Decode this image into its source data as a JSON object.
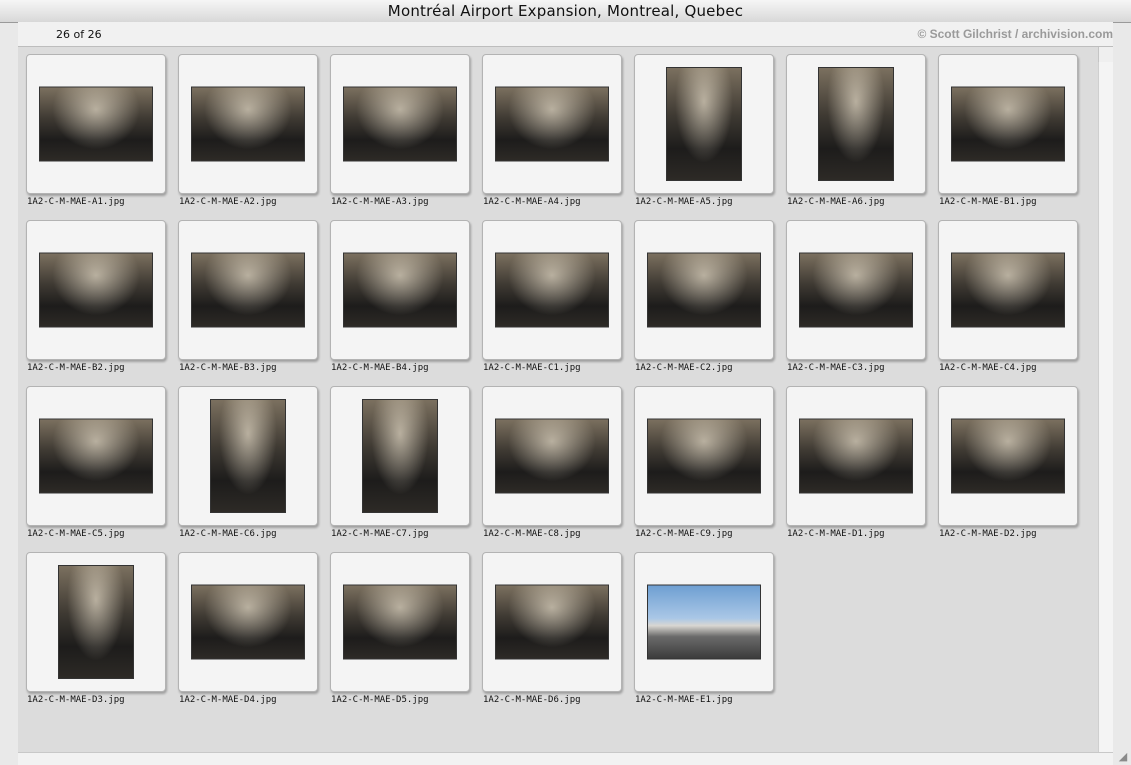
{
  "window": {
    "title": "Montréal Airport Expansion, Montreal, Quebec"
  },
  "header": {
    "counter": "26 of 26",
    "credit": "© Scott Gilchrist / archivision.com"
  },
  "thumbnails": [
    {
      "filename": "1A2-C-M-MAE-A1.jpg",
      "orientation": "landscape"
    },
    {
      "filename": "1A2-C-M-MAE-A2.jpg",
      "orientation": "landscape"
    },
    {
      "filename": "1A2-C-M-MAE-A3.jpg",
      "orientation": "landscape"
    },
    {
      "filename": "1A2-C-M-MAE-A4.jpg",
      "orientation": "landscape"
    },
    {
      "filename": "1A2-C-M-MAE-A5.jpg",
      "orientation": "portrait"
    },
    {
      "filename": "1A2-C-M-MAE-A6.jpg",
      "orientation": "portrait"
    },
    {
      "filename": "1A2-C-M-MAE-B1.jpg",
      "orientation": "landscape"
    },
    {
      "filename": "1A2-C-M-MAE-B2.jpg",
      "orientation": "landscape"
    },
    {
      "filename": "1A2-C-M-MAE-B3.jpg",
      "orientation": "landscape"
    },
    {
      "filename": "1A2-C-M-MAE-B4.jpg",
      "orientation": "landscape"
    },
    {
      "filename": "1A2-C-M-MAE-C1.jpg",
      "orientation": "landscape"
    },
    {
      "filename": "1A2-C-M-MAE-C2.jpg",
      "orientation": "landscape"
    },
    {
      "filename": "1A2-C-M-MAE-C3.jpg",
      "orientation": "landscape"
    },
    {
      "filename": "1A2-C-M-MAE-C4.jpg",
      "orientation": "landscape"
    },
    {
      "filename": "1A2-C-M-MAE-C5.jpg",
      "orientation": "landscape"
    },
    {
      "filename": "1A2-C-M-MAE-C6.jpg",
      "orientation": "portrait"
    },
    {
      "filename": "1A2-C-M-MAE-C7.jpg",
      "orientation": "portrait"
    },
    {
      "filename": "1A2-C-M-MAE-C8.jpg",
      "orientation": "landscape"
    },
    {
      "filename": "1A2-C-M-MAE-C9.jpg",
      "orientation": "landscape"
    },
    {
      "filename": "1A2-C-M-MAE-D1.jpg",
      "orientation": "landscape"
    },
    {
      "filename": "1A2-C-M-MAE-D2.jpg",
      "orientation": "landscape"
    },
    {
      "filename": "1A2-C-M-MAE-D3.jpg",
      "orientation": "portrait"
    },
    {
      "filename": "1A2-C-M-MAE-D4.jpg",
      "orientation": "landscape"
    },
    {
      "filename": "1A2-C-M-MAE-D5.jpg",
      "orientation": "landscape"
    },
    {
      "filename": "1A2-C-M-MAE-D6.jpg",
      "orientation": "landscape"
    },
    {
      "filename": "1A2-C-M-MAE-E1.jpg",
      "orientation": "landscape",
      "scene": "sky"
    }
  ]
}
